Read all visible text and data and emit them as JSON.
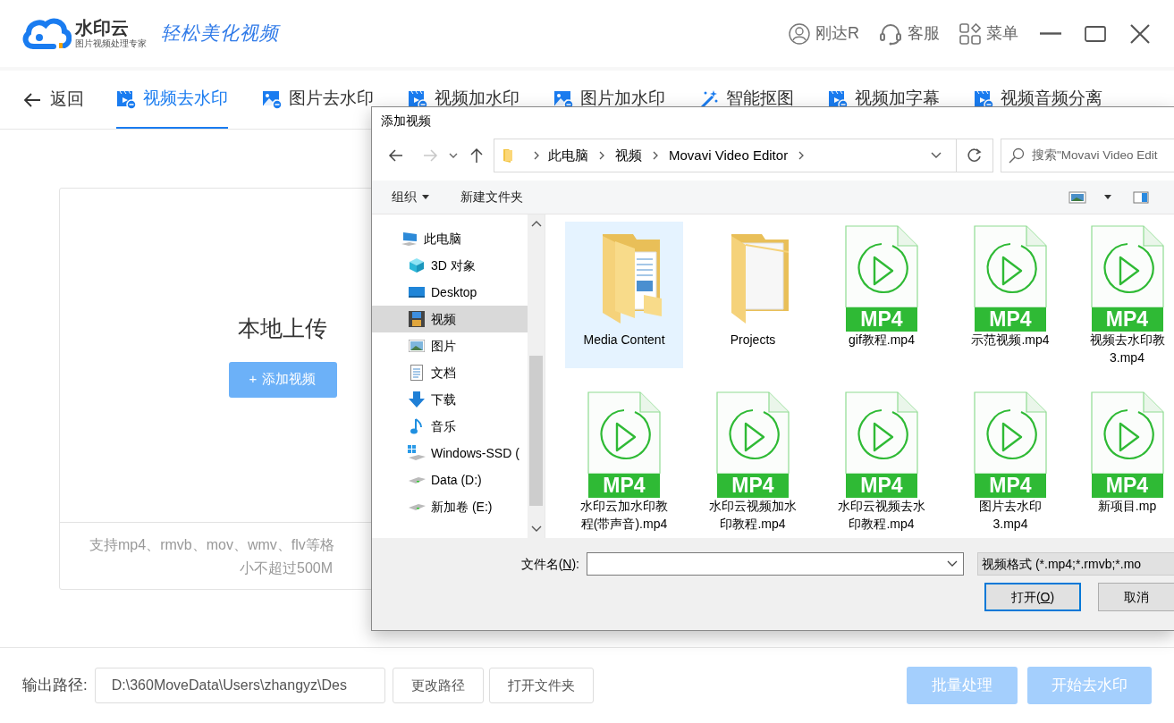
{
  "header": {
    "brand": "水印云",
    "brand_subtitle": "图片视频处理专家",
    "slogan": "轻松美化视频",
    "user": "刚达R",
    "support": "客服",
    "menu": "菜单"
  },
  "nav": {
    "back": "返回",
    "tabs": [
      {
        "label": "视频去水印",
        "kind": "video",
        "selected": true
      },
      {
        "label": "图片去水印",
        "kind": "image",
        "selected": false
      },
      {
        "label": "视频加水印",
        "kind": "video",
        "selected": false
      },
      {
        "label": "图片加水印",
        "kind": "image",
        "selected": false
      },
      {
        "label": "智能抠图",
        "kind": "wand",
        "selected": false
      },
      {
        "label": "视频加字幕",
        "kind": "video",
        "selected": false
      },
      {
        "label": "视频音频分离",
        "kind": "video",
        "selected": false
      }
    ]
  },
  "upload": {
    "title": "本地上传",
    "button_icon": "+",
    "button": "添加视频",
    "hint_lines": [
      "支持mp4、rmvb、mov、wmv、flv等格",
      "小不超过500M"
    ]
  },
  "footer": {
    "output_label": "输出路径:",
    "output_path": "D:\\360MoveData\\Users\\zhangyz\\Des",
    "change_button": "更改路径",
    "open_folder_button": "打开文件夹",
    "actions": [
      {
        "label": "批量处理",
        "disabled": true
      },
      {
        "label": "开始去水印",
        "disabled": true
      }
    ]
  },
  "dialog": {
    "title": "添加视频",
    "breadcrumb": [
      "此电脑",
      "视频",
      "Movavi Video Editor"
    ],
    "search_placeholder": "搜索\"Movavi Video Edit",
    "toolbar": {
      "organize": "组织",
      "new_folder": "新建文件夹"
    },
    "tree": [
      {
        "label": "此电脑",
        "kind": "pc",
        "selected": false,
        "children": [
          {
            "label": "3D 对象",
            "kind": "cube",
            "selected": false
          },
          {
            "label": "Desktop",
            "kind": "desktop",
            "selected": false
          },
          {
            "label": "视频",
            "kind": "film",
            "selected": true
          },
          {
            "label": "图片",
            "kind": "picture",
            "selected": false
          },
          {
            "label": "文档",
            "kind": "doc",
            "selected": false
          },
          {
            "label": "下载",
            "kind": "download",
            "selected": false
          },
          {
            "label": "音乐",
            "kind": "music",
            "selected": false
          },
          {
            "label": "Windows-SSD (",
            "kind": "windrive",
            "selected": false
          },
          {
            "label": "Data (D:)",
            "kind": "drive",
            "selected": false
          },
          {
            "label": "新加卷 (E:)",
            "kind": "drive",
            "selected": false
          }
        ]
      }
    ],
    "files": [
      {
        "kind": "media-folder",
        "label": [
          "Media Content"
        ],
        "selected": true
      },
      {
        "kind": "folder",
        "label": [
          "Projects"
        ],
        "selected": false
      },
      {
        "kind": "video",
        "badge": "MP4",
        "label": [
          "gif教程.mp4"
        ],
        "selected": false
      },
      {
        "kind": "video",
        "badge": "MP4",
        "label": [
          "示范视频.mp4"
        ],
        "selected": false
      },
      {
        "kind": "video",
        "badge": "MP4",
        "label": [
          "视频去水印教",
          "3.mp4"
        ],
        "selected": false
      },
      {
        "kind": "video",
        "badge": "MP4",
        "label": [
          "水印云加水印教",
          "程(带声音).mp4"
        ],
        "selected": false
      },
      {
        "kind": "video",
        "badge": "MP4",
        "label": [
          "水印云视频加水",
          "印教程.mp4"
        ],
        "selected": false
      },
      {
        "kind": "video",
        "badge": "MP4",
        "label": [
          "水印云视频去水",
          "印教程.mp4"
        ],
        "selected": false
      },
      {
        "kind": "video",
        "badge": "MP4",
        "label": [
          "图片去水印",
          "3.mp4"
        ],
        "selected": false
      },
      {
        "kind": "video",
        "badge": "MP4",
        "label": [
          "新项目.mp"
        ],
        "selected": false
      }
    ],
    "filename_label": [
      "文件名(",
      "N",
      "):"
    ],
    "file_type": "视频格式 (*.mp4;*.rmvb;*.mo",
    "open_button": [
      "打开(",
      "O",
      ")"
    ],
    "cancel_button": "取消"
  }
}
